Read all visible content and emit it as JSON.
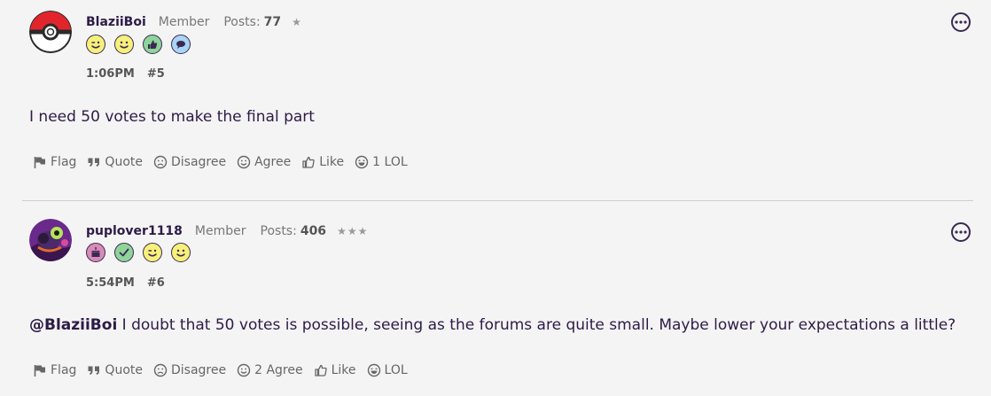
{
  "posts": [
    {
      "username": "BlaziiBoi",
      "role": "Member",
      "posts_label": "Posts:",
      "posts_count": "77",
      "stars": "★",
      "time": "1:06PM",
      "post_number": "#5",
      "body": "I need 50 votes to make the final part",
      "badges": [
        "wink-face-icon",
        "smile-face-icon",
        "thumbs-up-icon",
        "speech-bubble-icon"
      ],
      "actions": {
        "flag": "Flag",
        "quote": "Quote",
        "disagree": "Disagree",
        "agree": "Agree",
        "like": "Like",
        "lol": "1 LOL"
      }
    },
    {
      "username": "puplover1118",
      "role": "Member",
      "posts_label": "Posts:",
      "posts_count": "406",
      "stars": "★★★",
      "time": "5:54PM",
      "post_number": "#6",
      "mention": "@BlaziiBoi",
      "body": " I doubt that 50 votes is possible, seeing as the forums are quite small. Maybe lower your expectations a little?",
      "badges": [
        "cake-icon",
        "checkmark-icon",
        "wink-face-icon",
        "smile-face-icon"
      ],
      "actions": {
        "flag": "Flag",
        "quote": "Quote",
        "disagree": "Disagree",
        "agree": "2 Agree",
        "like": "Like",
        "lol": "LOL"
      }
    }
  ],
  "colors": {
    "background": "#f4f4f4",
    "text": "#2d1b47",
    "badge_yellow": "#f7f07a",
    "badge_green": "#8fd49a",
    "badge_blue": "#a9d4f5",
    "badge_pink": "#d98bb8"
  }
}
